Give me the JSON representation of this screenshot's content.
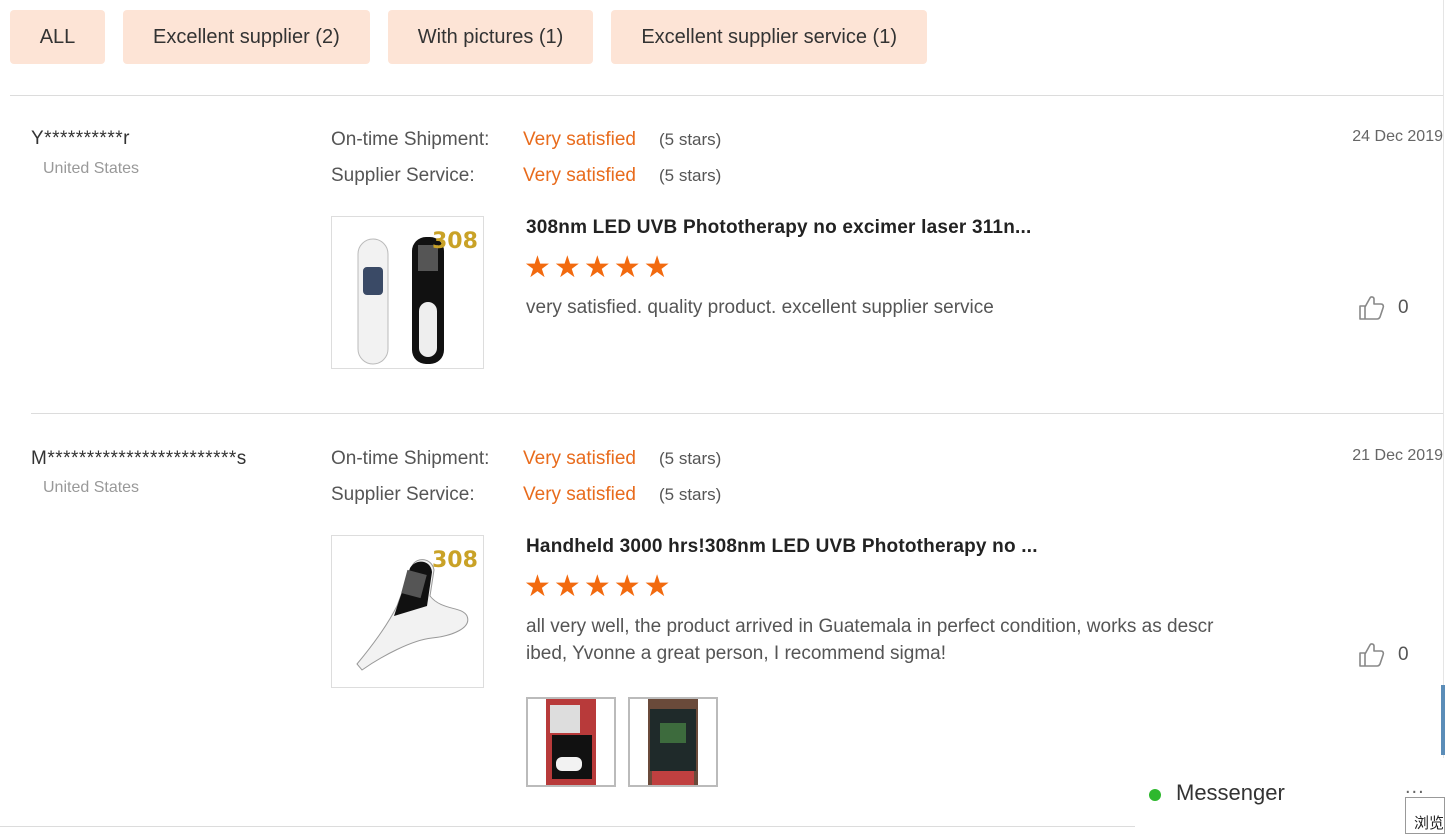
{
  "filters": [
    {
      "label": "ALL"
    },
    {
      "label": "Excellent supplier (2)"
    },
    {
      "label": "With pictures (1)"
    },
    {
      "label": "Excellent supplier service (1)"
    }
  ],
  "reviews": [
    {
      "reviewer": "Y**********r",
      "country": "United States",
      "ratings": [
        {
          "label": "On-time Shipment:",
          "value": "Very satisfied",
          "stars_text": "(5 stars)"
        },
        {
          "label": "Supplier Service:",
          "value": "Very satisfied",
          "stars_text": "(5 stars)"
        }
      ],
      "date": "24 Dec 2019",
      "product_title": "308nm LED UVB Phototherapy no excimer laser 311n...",
      "product_rating": 5,
      "text": "very satisfied.  quality product.  excellent supplier service",
      "likes": "0",
      "thumb_badge": "308"
    },
    {
      "reviewer": "M************************s",
      "country": "United States",
      "ratings": [
        {
          "label": "On-time Shipment:",
          "value": "Very satisfied",
          "stars_text": "(5 stars)"
        },
        {
          "label": "Supplier Service:",
          "value": "Very satisfied",
          "stars_text": "(5 stars)"
        }
      ],
      "date": "21 Dec 2019",
      "product_title": "Handheld 3000 hrs!308nm LED UVB Phototherapy no ...",
      "product_rating": 5,
      "text_line1": "all very well, the product arrived in Guatemala in perfect condition, works as descr",
      "text_line2": "ibed, Yvonne a great person, I recommend sigma!",
      "likes": "0",
      "thumb_badge": "308"
    }
  ],
  "messenger": {
    "label": "Messenger",
    "more": "...",
    "status_color": "#2eb82e"
  },
  "browse_tag": "浏览",
  "colors": {
    "accent": "#e86b1c",
    "filter_bg": "#fde4d6",
    "star": "#f26a0f"
  },
  "icons": [
    "thumbs-up-icon",
    "star-icon",
    "online-status-icon",
    "more-icon"
  ]
}
